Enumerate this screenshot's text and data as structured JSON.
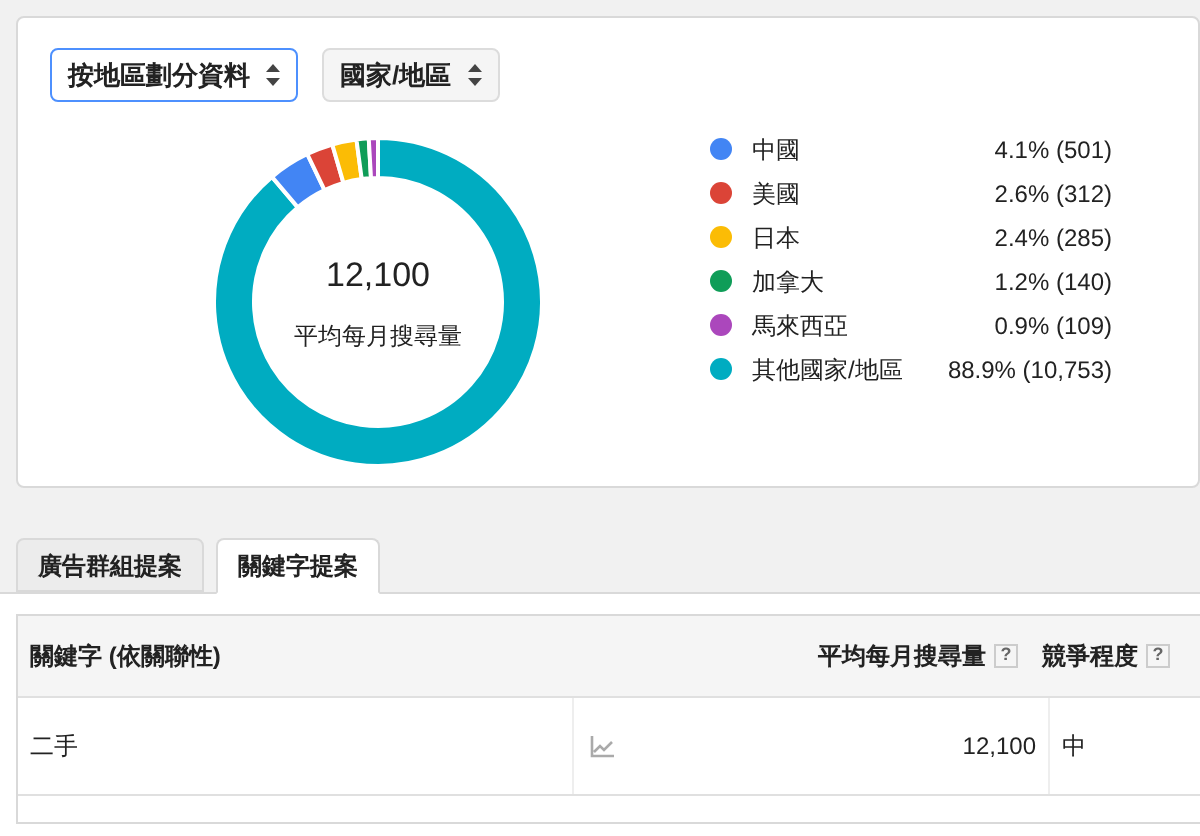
{
  "controls": [
    {
      "label": "按地區劃分資料",
      "selected": true
    },
    {
      "label": "國家/地區",
      "selected": false
    }
  ],
  "summary": {
    "value": "12,100",
    "label": "平均每月搜尋量"
  },
  "chart_data": {
    "type": "donut",
    "categories": [
      "中國",
      "美國",
      "日本",
      "加拿大",
      "馬來西亞",
      "其他國家/地區"
    ],
    "values": [
      4.1,
      2.6,
      2.4,
      1.2,
      0.9,
      88.9
    ]
  },
  "legend": [
    {
      "color": "#4285f4",
      "reading": "4.1% (501)"
    },
    {
      "color": "#db4437",
      "reading": "2.6% (312)"
    },
    {
      "color": "#fbbc05",
      "reading": "2.4% (285)"
    },
    {
      "color": "#0f9d58",
      "reading": "1.2% (140)"
    },
    {
      "color": "#ab47bc",
      "reading": "0.9% (109)"
    },
    {
      "color": "#00acc1",
      "reading": "88.9% (10,753)"
    }
  ],
  "tabs": [
    {
      "label": "廣告群組提案",
      "selected": false
    },
    {
      "label": "關鍵字提案",
      "selected": true
    }
  ],
  "table": {
    "columns": [
      "關鍵字 (依關聯性)",
      "平均每月搜尋量",
      "競爭程度"
    ],
    "help_mark": "?",
    "rows": [
      {
        "keyword": "二手",
        "volume": "12,100",
        "competition": "中"
      }
    ]
  }
}
